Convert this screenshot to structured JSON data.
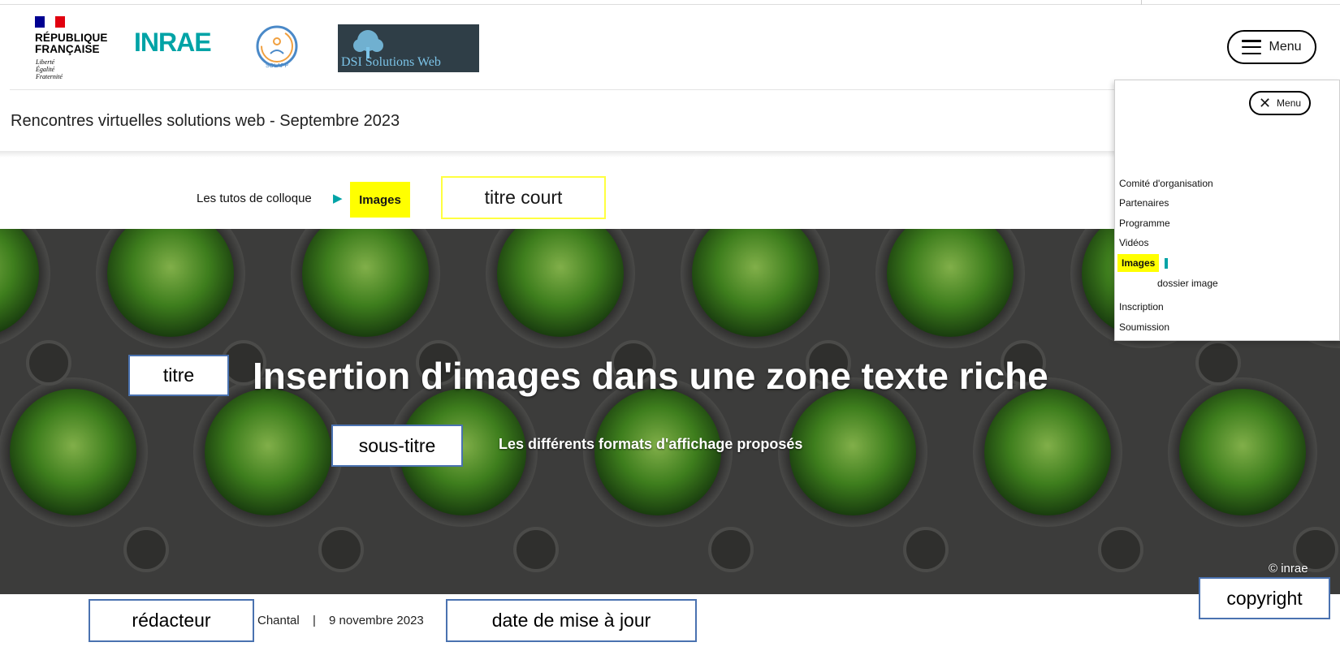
{
  "header": {
    "republique": [
      "RÉPUBLIQUE",
      "FRANÇAISE"
    ],
    "motto": [
      "Liberté",
      "Égalité",
      "Fraternité"
    ],
    "inrae_logo": "INRAE",
    "solapp_label": "SOLAPP",
    "dsi_label": "DSI Solutions Web",
    "menu_label": "Menu",
    "site_title": "Rencontres virtuelles solutions web - Septembre 2023"
  },
  "breadcrumb": {
    "parent": "Les tutos de colloque",
    "current": "Images"
  },
  "hero": {
    "title": "Insertion d'images dans une zone texte riche",
    "subtitle": "Les différents formats d'affichage proposés",
    "copyright": "© inrae"
  },
  "annotations": {
    "titre_court": "titre court",
    "titre": "titre",
    "sous_titre": "sous-titre",
    "redacteur": "rédacteur",
    "date_maj": "date de mise à jour",
    "copyright": "copyright"
  },
  "meta": {
    "author": "Chantal",
    "separator": "|",
    "date": "9 novembre 2023"
  },
  "menu_panel": {
    "close_label": "Menu",
    "items": [
      {
        "label": "Comité d'organisation"
      },
      {
        "label": "Partenaires"
      },
      {
        "label": "Programme"
      },
      {
        "label": "Vidéos"
      },
      {
        "label": "Images",
        "active": true
      },
      {
        "label": "dossier image",
        "sub": true
      },
      {
        "label": "Inscription"
      },
      {
        "label": "Soumission"
      }
    ]
  },
  "colors": {
    "accent": "#00a3a6",
    "highlight": "#ffff00",
    "annotation_border": "#4a72b0"
  }
}
